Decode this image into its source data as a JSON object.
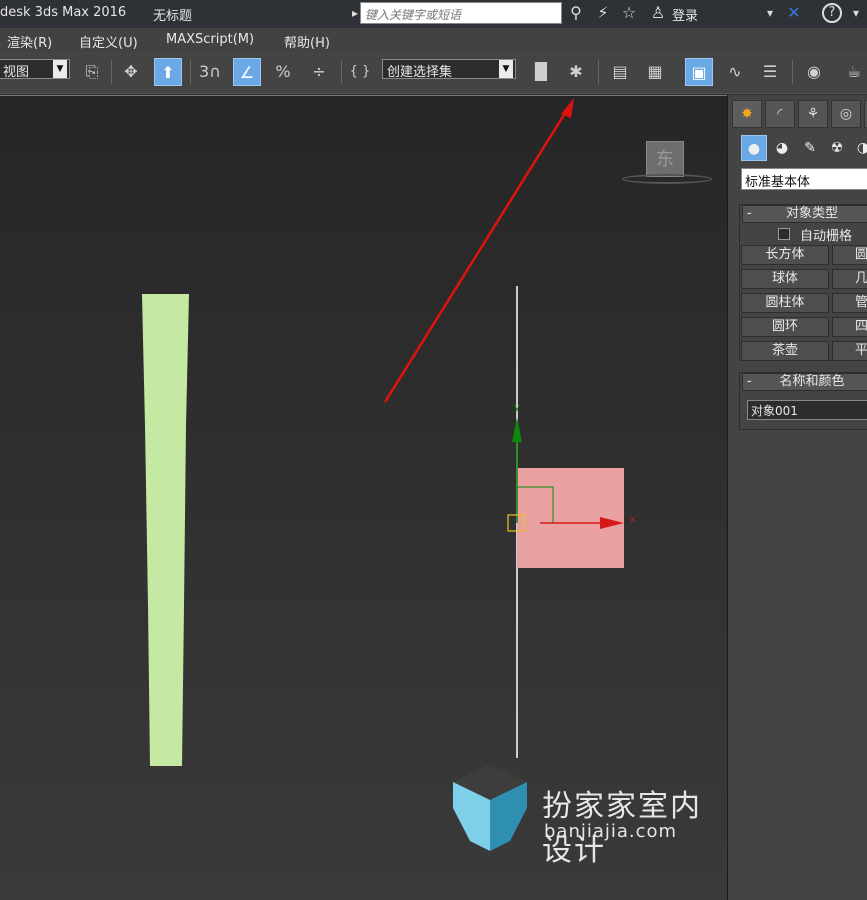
{
  "titlebar": {
    "app_title": "desk 3ds Max 2016",
    "doc_title": "无标题",
    "search_placeholder": "键入关键字或短语",
    "login": "登录",
    "help_icon": "?",
    "dropdown_arrow": "▾"
  },
  "menubar": {
    "items": [
      "渲染(R)",
      "自定义(U)",
      "MAXScript(M)",
      "帮助(H)"
    ]
  },
  "toolbar": {
    "view_dropdown": "视图",
    "selection_set": "创建选择集",
    "snap_number": "3",
    "icons": {
      "named-selection": "⎘",
      "move": "✥",
      "select-pivot": "⬆",
      "snap-3d": "∩",
      "angle-snap": "∠",
      "percent-snap": "%",
      "spinner-snap": "÷",
      "edit-named": "{ }",
      "mirror": "▐▌",
      "align": "✱",
      "layer-explorer": "▤",
      "ribbon": "▦",
      "scene-explorer": "▣",
      "curve-editor": "∿",
      "schematic": "☰",
      "material-editor": "◉",
      "render-setup": "☕"
    }
  },
  "viewport": {
    "viewcube_label": "东",
    "axis_y": "y",
    "axis_x": "x",
    "colors": {
      "green_object": "#c5e8a3",
      "pink_object": "#e9a0a0",
      "gizmo_green": "#0c8a0c",
      "gizmo_red": "#d71818",
      "annotation_arrow": "#e0120d"
    }
  },
  "cmdpanel": {
    "tabs": [
      "✸",
      "◜",
      "⚘",
      "◎",
      "▢"
    ],
    "subicons": [
      "●",
      "◕",
      "✎",
      "☢",
      "◑"
    ],
    "category": "标准基本体",
    "rollout_object_type": "对象类型",
    "rollout_minus": "-",
    "autogrid": "自动栅格",
    "buttons": [
      "长方体",
      "圆",
      "球体",
      "几何",
      "圆柱体",
      "管",
      "圆环",
      "四",
      "茶壶",
      "平"
    ],
    "rollout_name_color": "名称和颜色",
    "object_name": "对象001"
  },
  "watermark": {
    "text": "扮家家室内设计",
    "url": "banjiajia.com",
    "cube_colors": [
      "#3d3d3d",
      "#7ed0e8",
      "#2f8fb0"
    ]
  }
}
